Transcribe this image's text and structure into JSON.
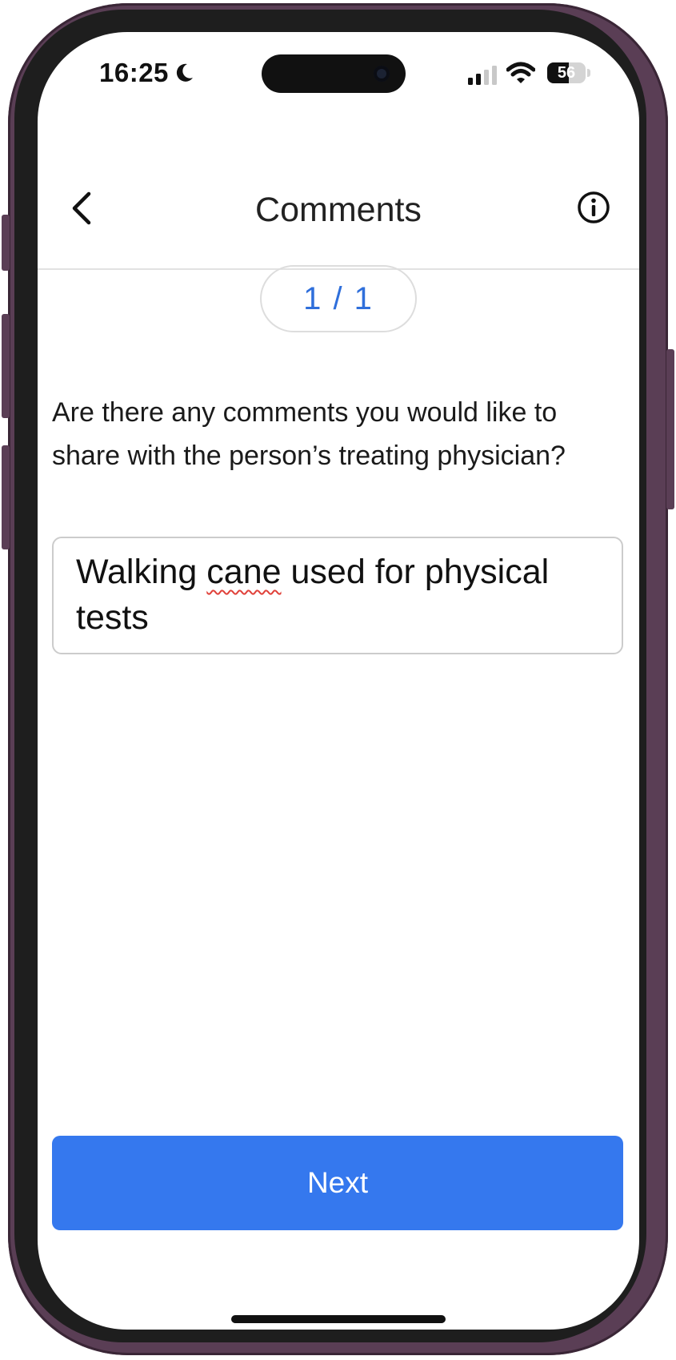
{
  "status_bar": {
    "time": "16:25",
    "battery_level": "56",
    "battery_percent": 56
  },
  "nav": {
    "title": "Comments"
  },
  "pager": {
    "label": "1 / 1"
  },
  "question": {
    "text": "Are there any comments you would like to share with the person’s treating physician?"
  },
  "answer": {
    "word_1": "Walking",
    "word_2": "cane",
    "rest": "used for physical tests"
  },
  "actions": {
    "next_label": "Next"
  },
  "colors": {
    "accent": "#3578ee",
    "pager_text": "#2f6fdb",
    "spellcheck": "#e0413a"
  }
}
